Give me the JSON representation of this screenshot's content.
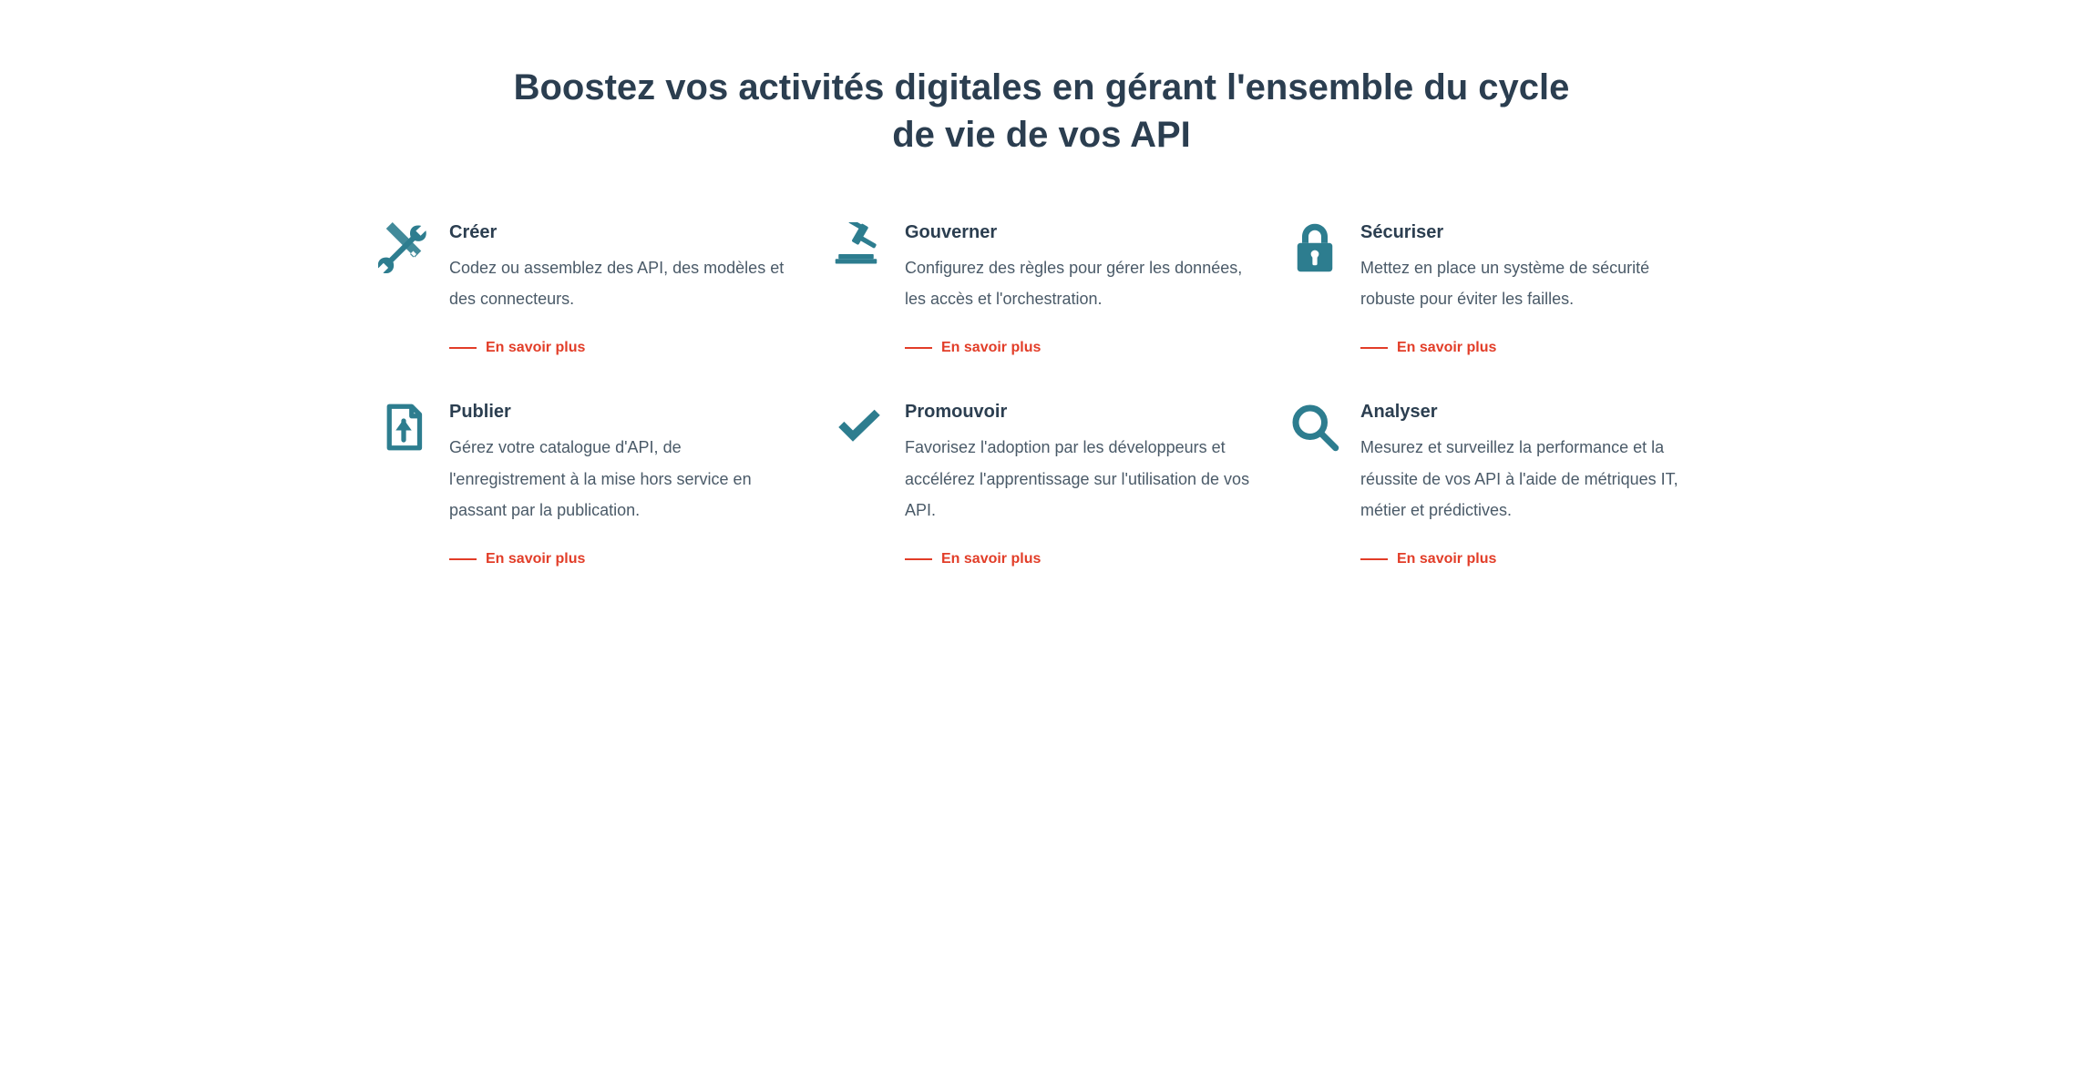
{
  "title": "Boostez vos activités digitales en gérant l'ensemble du cycle de vie de vos API",
  "learn_more_label": "En savoir plus",
  "features": [
    {
      "icon": "tools-icon",
      "title": "Créer",
      "desc": "Codez ou assemblez des API, des modèles et des connecteurs."
    },
    {
      "icon": "gavel-icon",
      "title": "Gouverner",
      "desc": "Configurez des règles pour gérer les données, les accès et l'orchestration."
    },
    {
      "icon": "lock-icon",
      "title": "Sécuriser",
      "desc": "Mettez en place un système de sécurité robuste pour éviter les failles."
    },
    {
      "icon": "publish-icon",
      "title": "Publier",
      "desc": "Gérez votre catalogue d'API, de l'enregistrement à la mise hors service en passant par la publication."
    },
    {
      "icon": "check-icon",
      "title": "Promouvoir",
      "desc": "Favorisez l'adoption par les développeurs et accélérez l'apprentissage sur l'utilisation de vos API."
    },
    {
      "icon": "magnify-icon",
      "title": "Analyser",
      "desc": "Mesurez et surveillez la performance et la réussite de vos API à l'aide de métriques IT, métier et prédictives."
    }
  ]
}
